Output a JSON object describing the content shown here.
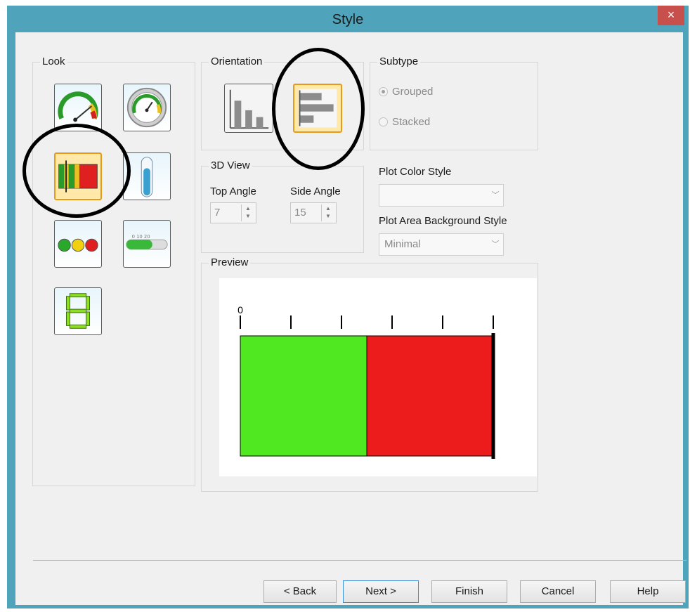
{
  "window": {
    "title": "Style",
    "close_glyph": "×"
  },
  "look": {
    "label": "Look",
    "items": [
      {
        "name": "gauge-colored-icon",
        "selected": false
      },
      {
        "name": "gauge-gray-icon",
        "selected": false
      },
      {
        "name": "linear-bar-icon",
        "selected": true
      },
      {
        "name": "thermometer-icon",
        "selected": false
      },
      {
        "name": "traffic-light-icon",
        "selected": false
      },
      {
        "name": "slider-scale-icon",
        "selected": false
      },
      {
        "name": "digital-display-icon",
        "selected": false
      }
    ]
  },
  "orientation": {
    "label": "Orientation",
    "items": [
      {
        "name": "vertical-bars-icon",
        "selected": false
      },
      {
        "name": "horizontal-bars-icon",
        "selected": true
      }
    ]
  },
  "subtype": {
    "label": "Subtype",
    "options": [
      {
        "label": "Grouped",
        "checked": true
      },
      {
        "label": "Stacked",
        "checked": false
      }
    ]
  },
  "view3d": {
    "label": "3D View",
    "top_angle_label": "Top Angle",
    "top_angle_value": "7",
    "side_angle_label": "Side Angle",
    "side_angle_value": "15"
  },
  "plot_color_style": {
    "label": "Plot Color Style",
    "value": ""
  },
  "plot_area_background_style": {
    "label": "Plot Area Background Style",
    "value": "Minimal"
  },
  "preview": {
    "label": "Preview"
  },
  "chart_data": {
    "type": "bar",
    "orientation": "horizontal",
    "tick_labels": [
      "0"
    ],
    "tick_count": 6,
    "segments": [
      {
        "color": "#50e820",
        "fraction": 0.5
      },
      {
        "color": "#ed1c1c",
        "fraction": 0.5
      }
    ],
    "marker_fraction": 1.0
  },
  "buttons": {
    "back": "< Back",
    "next": "Next >",
    "finish": "Finish",
    "cancel": "Cancel",
    "help": "Help"
  },
  "colors": {
    "titlebar": "#4fa3bb",
    "close": "#c7504d",
    "selection": "#e39b1b"
  }
}
